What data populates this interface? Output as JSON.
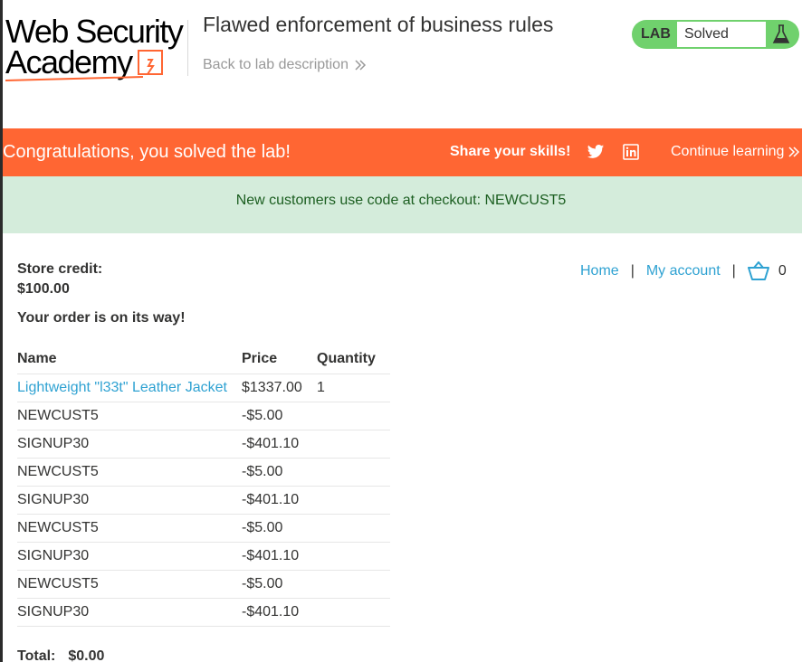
{
  "logo": {
    "line1": "Web Security",
    "line2": "Academy"
  },
  "header": {
    "lab_title": "Flawed enforcement of business rules",
    "back_link": "Back to lab description"
  },
  "lab_status": {
    "label": "LAB",
    "value": "Solved",
    "color": "#70d16d"
  },
  "banner": {
    "congrats": "Congratulations, you solved the lab!",
    "share": "Share your skills!",
    "continue": "Continue learning",
    "color": "#ff6633"
  },
  "notice": {
    "text": "New customers use code at checkout: NEWCUST5"
  },
  "account": {
    "store_credit_label": "Store credit:",
    "store_credit_value": "$100.00",
    "order_status": "Your order is on its way!"
  },
  "nav": {
    "home": "Home",
    "sep": "|",
    "my_account": "My account",
    "cart_count": "0"
  },
  "table": {
    "headers": {
      "name": "Name",
      "price": "Price",
      "quantity": "Quantity"
    },
    "rows": [
      {
        "name": "Lightweight \"l33t\" Leather Jacket",
        "price": "$1337.00",
        "quantity": "1"
      },
      {
        "name": "NEWCUST5",
        "price": "-$5.00",
        "quantity": ""
      },
      {
        "name": "SIGNUP30",
        "price": "-$401.10",
        "quantity": ""
      },
      {
        "name": "NEWCUST5",
        "price": "-$5.00",
        "quantity": ""
      },
      {
        "name": "SIGNUP30",
        "price": "-$401.10",
        "quantity": ""
      },
      {
        "name": "NEWCUST5",
        "price": "-$5.00",
        "quantity": ""
      },
      {
        "name": "SIGNUP30",
        "price": "-$401.10",
        "quantity": ""
      },
      {
        "name": "NEWCUST5",
        "price": "-$5.00",
        "quantity": ""
      },
      {
        "name": "SIGNUP30",
        "price": "-$401.10",
        "quantity": ""
      }
    ]
  },
  "total": {
    "label": "Total:",
    "value": "$0.00"
  },
  "icons": {
    "back": "double-chevron-right-icon",
    "lab": "flask-icon",
    "twitter": "twitter-icon",
    "linkedin": "linkedin-icon",
    "continue": "double-chevron-right-icon",
    "cart": "cart-icon"
  }
}
